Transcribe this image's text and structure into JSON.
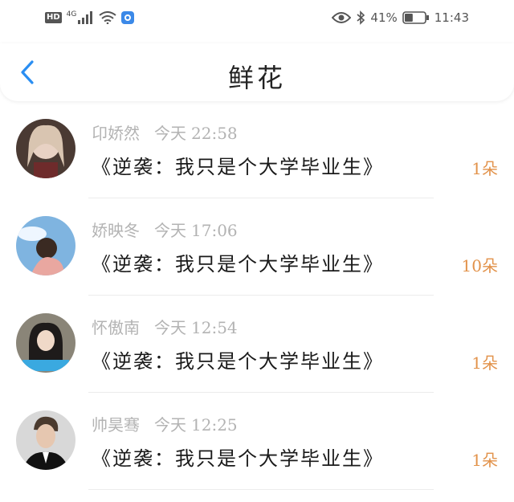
{
  "status_bar": {
    "hd": "HD",
    "network": "4G",
    "battery_percent": "41%",
    "time": "11:43",
    "battery_level": 0.41
  },
  "header": {
    "title": "鲜花",
    "back_icon": "chevron-left-icon",
    "accent": "#2a8ef2"
  },
  "flowers": [
    {
      "name": "卬娇然",
      "date": "今天",
      "time": "22:58",
      "book": "《逆袭：我只是个大学毕业生》",
      "count": "1朵"
    },
    {
      "name": "娇映冬",
      "date": "今天",
      "time": "17:06",
      "book": "《逆袭：我只是个大学毕业生》",
      "count": "10朵"
    },
    {
      "name": "怀傲南",
      "date": "今天",
      "time": "12:54",
      "book": "《逆袭：我只是个大学毕业生》",
      "count": "1朵"
    },
    {
      "name": "帅昊骞",
      "date": "今天",
      "time": "12:25",
      "book": "《逆袭：我只是个大学毕业生》",
      "count": "1朵"
    }
  ],
  "colors": {
    "count": "#e2924a",
    "meta": "#b3b3b3"
  }
}
